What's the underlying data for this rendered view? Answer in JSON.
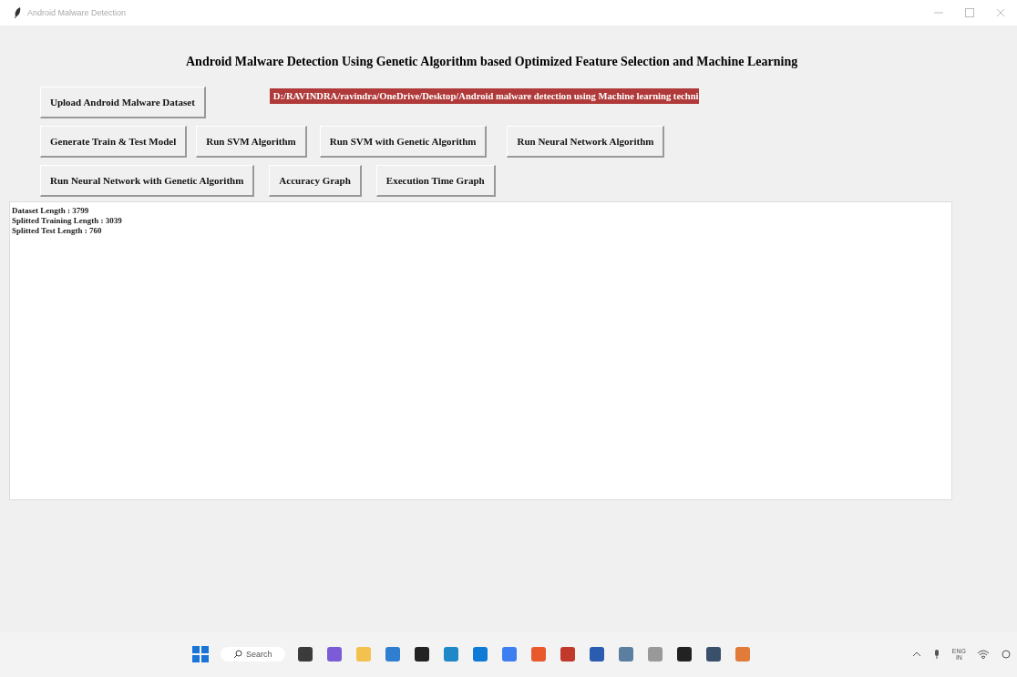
{
  "window": {
    "title": "Android Malware Detection"
  },
  "heading": "Android Malware Detection Using Genetic Algorithm based Optimized Feature Selection and Machine Learning",
  "path_label": "D:/RAVINDRA/ravindra/OneDrive/Desktop/Android malware detection using Machine learning techni",
  "button_rows": [
    [
      "Upload Android Malware Dataset"
    ],
    [
      "Generate Train & Test Model",
      "Run SVM Algorithm",
      "Run SVM with Genetic Algorithm",
      "Run Neural Network Algorithm"
    ],
    [
      "Run Neural Network with Genetic Algorithm",
      "Accuracy Graph",
      "Execution Time Graph"
    ]
  ],
  "output_lines": [
    "Dataset Length : 3799",
    "Splitted Training Length : 3039",
    "Splitted Test Length : 760"
  ],
  "taskbar": {
    "search": "Search",
    "language": "ENG",
    "region": "IN"
  }
}
